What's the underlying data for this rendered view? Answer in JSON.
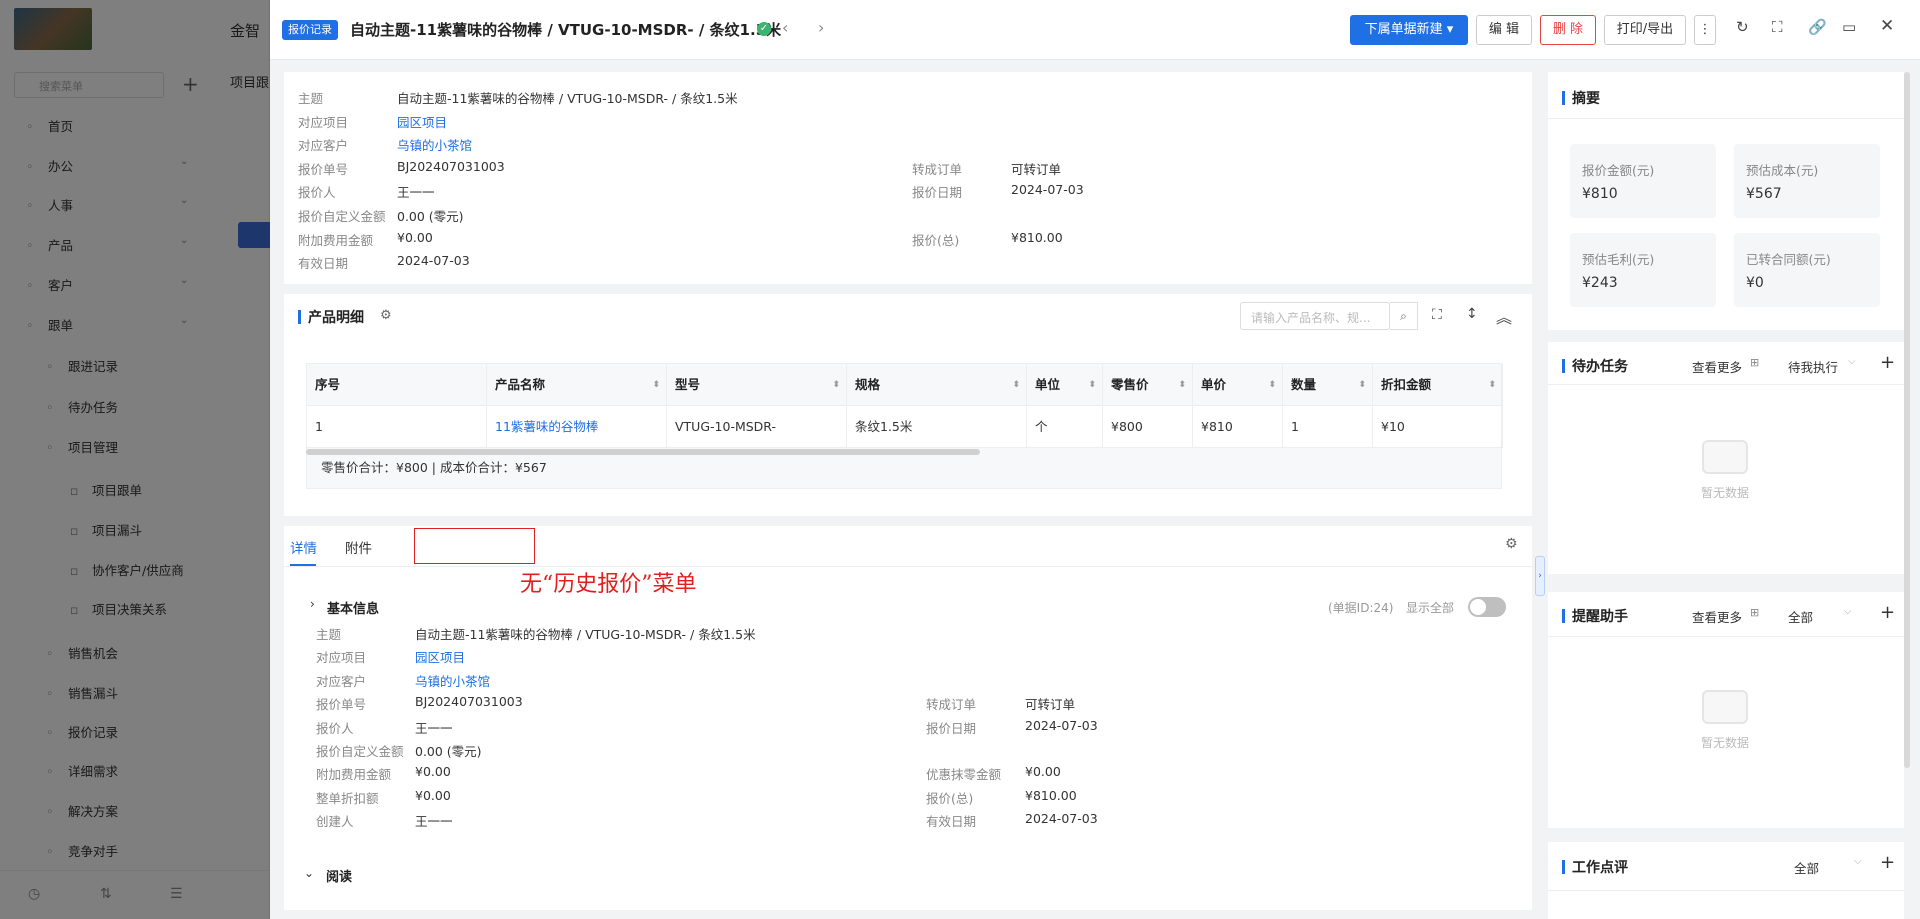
{
  "background": {
    "app_title": "金智",
    "search_placeholder": "搜索菜单",
    "crumb": "项目跟",
    "nav": [
      {
        "label": "首页",
        "level": 0
      },
      {
        "label": "办公",
        "level": 0
      },
      {
        "label": "人事",
        "level": 0
      },
      {
        "label": "产品",
        "level": 0
      },
      {
        "label": "客户",
        "level": 0
      },
      {
        "label": "跟单",
        "level": 0
      },
      {
        "label": "跟进记录",
        "level": 1
      },
      {
        "label": "待办任务",
        "level": 1
      },
      {
        "label": "项目管理",
        "level": 1
      },
      {
        "label": "项目跟单",
        "level": 2
      },
      {
        "label": "项目漏斗",
        "level": 2
      },
      {
        "label": "协作客户/供应商",
        "level": 2
      },
      {
        "label": "项目决策关系",
        "level": 2
      },
      {
        "label": "销售机会",
        "level": 1
      },
      {
        "label": "销售漏斗",
        "level": 1
      },
      {
        "label": "报价记录",
        "level": 1
      },
      {
        "label": "详细需求",
        "level": 1
      },
      {
        "label": "解决方案",
        "level": 1
      },
      {
        "label": "竞争对手",
        "level": 1
      }
    ]
  },
  "header": {
    "tag": "报价记录",
    "title": "自动主题-11紫薯味的谷物棒 / VTUG-10-MSDR- / 条纹1.5米",
    "btn_new": "下属单据新建",
    "btn_edit": "编 辑",
    "btn_delete": "删 除",
    "btn_print": "打印/导出"
  },
  "top_fields": {
    "subject_l": "主题",
    "subject_v": "自动主题-11紫薯味的谷物棒 / VTUG-10-MSDR- / 条纹1.5米",
    "project_l": "对应项目",
    "project_v": "园区项目",
    "customer_l": "对应客户",
    "customer_v": "乌镇的小茶馆",
    "no_l": "报价单号",
    "no_v": "BJ202407031003",
    "person_l": "报价人",
    "person_v": "王一一",
    "custom_l": "报价自定义金额",
    "custom_v": "0.00 (零元)",
    "extra_l": "附加费用金额",
    "extra_v": "¥0.00",
    "valid_l": "有效日期",
    "valid_v": "2024-07-03",
    "order_l": "转成订单",
    "order_v": "可转订单",
    "date_l": "报价日期",
    "date_v": "2024-07-03",
    "total_l": "报价(总)",
    "total_v": "¥810.00"
  },
  "products": {
    "title": "产品明细",
    "search_placeholder": "请输入产品名称、规...",
    "columns": [
      "序号",
      "产品名称",
      "型号",
      "规格",
      "单位",
      "零售价",
      "单价",
      "数量",
      "折扣金额"
    ],
    "rows": [
      [
        "1",
        "11紫薯味的谷物棒",
        "VTUG-10-MSDR-",
        "条纹1.5米",
        "个",
        "¥800",
        "¥810",
        "1",
        "¥10"
      ]
    ],
    "summary": "零售价合计：¥800 |   成本价合计：¥567"
  },
  "tabs": {
    "detail": "详情",
    "attach": "附件"
  },
  "annotation": "无“历史报价”菜单",
  "basic": {
    "title": "基本信息",
    "doc_id": "(单据ID:24)",
    "show_all": "显示全部",
    "subject_l": "主题",
    "subject_v": "自动主题-11紫薯味的谷物棒 / VTUG-10-MSDR- / 条纹1.5米",
    "project_l": "对应项目",
    "project_v": "园区项目",
    "customer_l": "对应客户",
    "customer_v": "乌镇的小茶馆",
    "no_l": "报价单号",
    "no_v": "BJ202407031003",
    "person_l": "报价人",
    "person_v": "王一一",
    "custom_l": "报价自定义金额",
    "custom_v": "0.00 (零元)",
    "extra_l": "附加费用金额",
    "extra_v": "¥0.00",
    "discount_l": "整单折扣额",
    "discount_v": "¥0.00",
    "creator_l": "创建人",
    "creator_v": "王一一",
    "order_l": "转成订单",
    "order_v": "可转订单",
    "date_l": "报价日期",
    "date_v": "2024-07-03",
    "round_l": "优惠抹零金额",
    "round_v": "¥0.00",
    "total_l": "报价(总)",
    "total_v": "¥810.00",
    "valid_l": "有效日期",
    "valid_v": "2024-07-03",
    "read": "阅读"
  },
  "summary": {
    "title": "摘要",
    "items": [
      {
        "label": "报价金额(元)",
        "value": "¥810"
      },
      {
        "label": "预估成本(元)",
        "value": "¥567"
      },
      {
        "label": "预估毛利(元)",
        "value": "¥243"
      },
      {
        "label": "已转合同额(元)",
        "value": "¥0"
      }
    ]
  },
  "todo": {
    "title": "待办任务",
    "more": "查看更多",
    "filter": "待我执行",
    "empty": "暂无数据"
  },
  "reminder": {
    "title": "提醒助手",
    "more": "查看更多",
    "filter": "全部",
    "empty": "暂无数据"
  },
  "review": {
    "title": "工作点评",
    "filter": "全部"
  },
  "colors": {
    "primary": "#1f6fe5",
    "danger": "#e64545",
    "annotation": "#e02020",
    "success": "#3cb371"
  }
}
